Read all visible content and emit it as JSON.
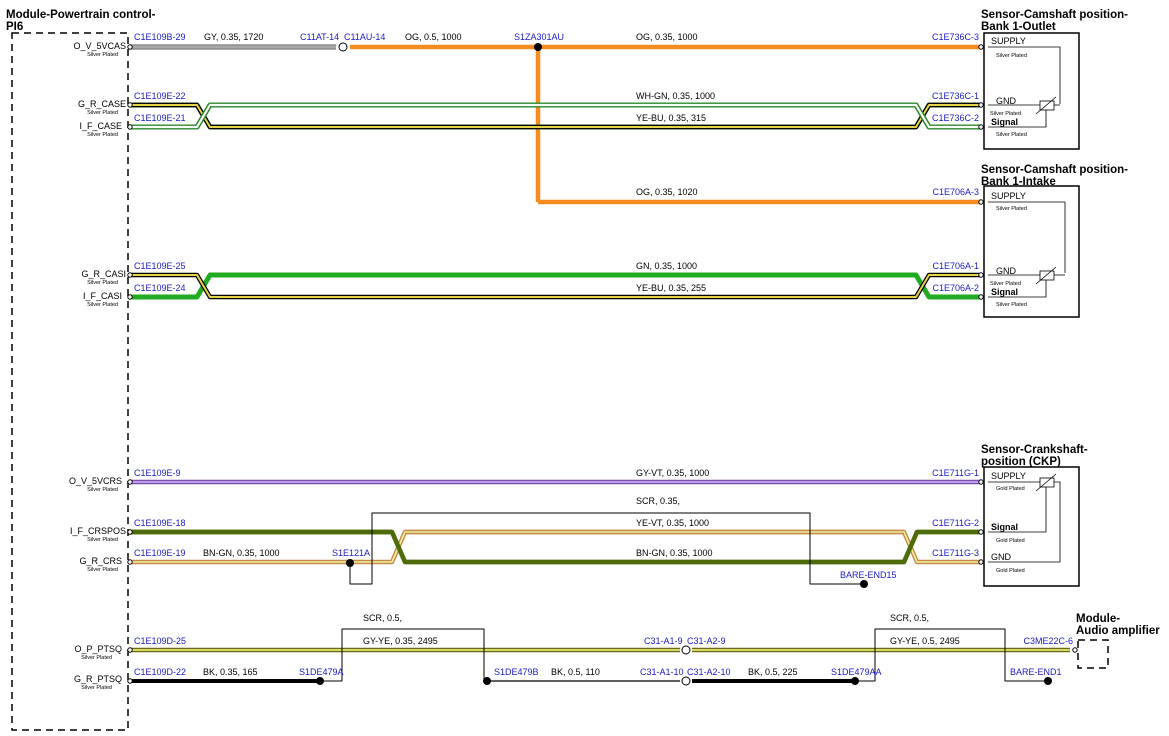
{
  "modules": {
    "pcm": {
      "title1": "Module-Powertrain control-",
      "title2": "PI6"
    },
    "cam_outlet": {
      "title1": "Sensor-Camshaft position-",
      "title2": "Bank 1-Outlet"
    },
    "cam_intake": {
      "title1": "Sensor-Camshaft position-",
      "title2": "Bank 1-Intake"
    },
    "ckp": {
      "title1": "Sensor-Crankshaft-",
      "title2": "position (CKP)"
    },
    "audio": {
      "title1": "Module-",
      "title2": "Audio amplifier"
    }
  },
  "pcm_pins": [
    {
      "name": "O_V_5VCAS",
      "plating": "Silver Plated"
    },
    {
      "name": "G_R_CASE",
      "plating": "Silver Plated"
    },
    {
      "name": "I_F_CASE",
      "plating": "Silver Plated"
    },
    {
      "name": "G_R_CASI",
      "plating": "Silver Plated"
    },
    {
      "name": "I_F_CASI",
      "plating": "Silver Plated"
    },
    {
      "name": "O_V_5VCRS",
      "plating": "Silver Plated"
    },
    {
      "name": "I_F_CRSPOS",
      "plating": "Silver Plated"
    },
    {
      "name": "G_R_CRS",
      "plating": "Silver Plated"
    },
    {
      "name": "O_P_PTSQ",
      "plating": "Silver Plated"
    },
    {
      "name": "G_R_PTSQ",
      "plating": "Silver Plated"
    }
  ],
  "sensor_pins": [
    {
      "name": "SUPPLY",
      "plating": "Silver Plated"
    },
    {
      "name": "GND",
      "plating": "Silver Plated"
    },
    {
      "name": "Signal",
      "plating": "Silver Plated"
    },
    {
      "name": "SUPPLY",
      "plating": "Silver Plated"
    },
    {
      "name": "GND",
      "plating": "Silver Plated"
    },
    {
      "name": "Signal",
      "plating": "Silver Plated"
    },
    {
      "name": "SUPPLY",
      "plating": "Gold Plated"
    },
    {
      "name": "Signal",
      "plating": "Gold Plated"
    },
    {
      "name": "GND",
      "plating": "Gold Plated"
    }
  ],
  "connectors": [
    "C1E109B-29",
    "C11AT-14",
    "C11AU-14",
    "S1ZA301AU",
    "C1E736C-3",
    "C1E109E-22",
    "C1E109E-21",
    "C1E736C-1",
    "C1E736C-2",
    "C1E706A-3",
    "C1E109E-25",
    "C1E109E-24",
    "C1E706A-1",
    "C1E706A-2",
    "C1E109E-9",
    "C1E711G-1",
    "C1E109E-18",
    "C1E109E-19",
    "S1E121A",
    "C1E711G-2",
    "C1E711G-3",
    "BARE-END15",
    "C1E109D-25",
    "C1E109D-22",
    "S1DE479A",
    "S1DE479B",
    "C31-A1-9",
    "C31-A2-9",
    "C31-A1-10",
    "C31-A2-10",
    "S1DE479AA",
    "C3ME22C-6",
    "BARE-END1"
  ],
  "wires": [
    "GY,  0.35,  1720",
    "OG,  0.5,  1000",
    "OG,  0.35,  1000",
    "WH-GN,  0.35,  1000",
    "YE-BU,  0.35,  315",
    "OG,  0.35,  1020",
    "GN,  0.35,  1000",
    "YE-BU,  0.35,  255",
    "GY-VT,  0.35,  1000",
    "SCR,  0.35,",
    "YE-VT,  0.35,  1000",
    "BN-GN,  0.35,  1000",
    "BN-GN,  0.35,  1000",
    "SCR,  0.5,",
    "GY-YE,  0.35,  2495",
    "BK,  0.35,  165",
    "BK,  0.5,  110",
    "BK,  0.5,  225",
    "SCR,  0.5,",
    "GY-YE,  0.5,  2495"
  ],
  "colors": {
    "gray": "#a8a8a8",
    "orange": "#f68b1f",
    "green": "#22aa22",
    "violet": "#a66fd9",
    "olive": "#4d6b0a",
    "yellow": "#d8d84a",
    "black": "#000000",
    "connector_blue": "#1a1acc"
  }
}
